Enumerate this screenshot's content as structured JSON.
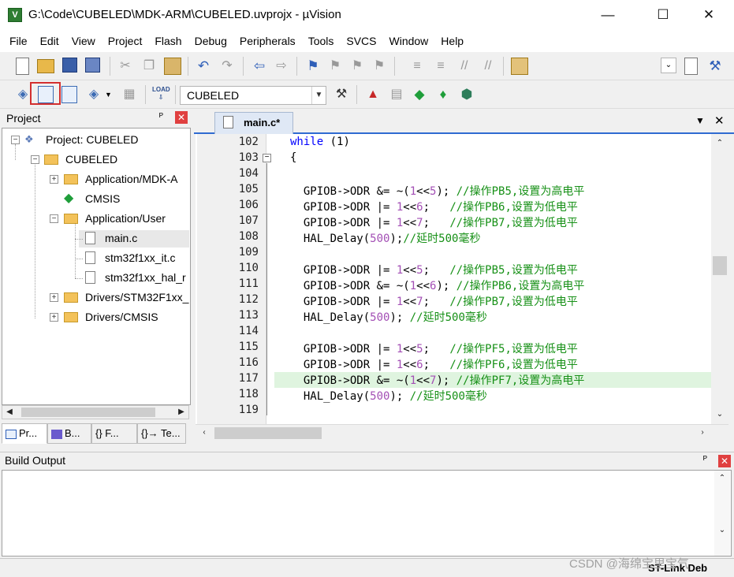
{
  "window": {
    "title": "G:\\Code\\CUBELED\\MDK-ARM\\CUBELED.uvprojx - µVision",
    "controls": {
      "minimize": "—",
      "maximize": "☐",
      "close": "✕"
    }
  },
  "menu": [
    "File",
    "Edit",
    "View",
    "Project",
    "Flash",
    "Debug",
    "Peripherals",
    "Tools",
    "SVCS",
    "Window",
    "Help"
  ],
  "toolbar2": {
    "target_value": "CUBELED",
    "highlight_color": "#d32f2f"
  },
  "project_panel": {
    "title": "Project",
    "pin": "ᴾ",
    "close": "✕",
    "tree": [
      {
        "label": "Project: CUBELED",
        "icon": "project-icon"
      },
      {
        "label": "CUBELED",
        "icon": "target-icon"
      },
      {
        "label": "Application/MDK-A",
        "icon": "folder-icon"
      },
      {
        "label": "CMSIS",
        "icon": "cmsis-icon"
      },
      {
        "label": "Application/User",
        "icon": "folder-icon"
      },
      {
        "label": "main.c",
        "icon": "file-icon"
      },
      {
        "label": "stm32f1xx_it.c",
        "icon": "file-icon"
      },
      {
        "label": "stm32f1xx_hal_r",
        "icon": "file-icon"
      },
      {
        "label": "Drivers/STM32F1xx_",
        "icon": "folder-icon"
      },
      {
        "label": "Drivers/CMSIS",
        "icon": "folder-icon"
      }
    ],
    "tabs": [
      "Pr...",
      "B...",
      "{} F...",
      "{}→ Te..."
    ]
  },
  "editor": {
    "tab_label": "main.c*",
    "menu_arrow": "▼",
    "close": "✕",
    "highlight_color": "#dff4df",
    "lines": [
      {
        "n": "102",
        "code": [
          [
            "kw",
            "while"
          ],
          [
            "",
            " (1)"
          ]
        ]
      },
      {
        "n": "103",
        "code": [
          [
            "",
            "{"
          ]
        ]
      },
      {
        "n": "104",
        "code": []
      },
      {
        "n": "105",
        "code": [
          [
            "",
            "  GPIOB->ODR &= ~("
          ],
          [
            "num",
            "1"
          ],
          [
            "",
            "<<"
          ],
          [
            "num",
            "5"
          ],
          [
            "",
            "); "
          ],
          [
            "cm",
            "//操作PB5,设置为高电平"
          ]
        ]
      },
      {
        "n": "106",
        "code": [
          [
            "",
            "  GPIOB->ODR |= "
          ],
          [
            "num",
            "1"
          ],
          [
            "",
            "<<"
          ],
          [
            "num",
            "6"
          ],
          [
            "",
            ";   "
          ],
          [
            "cm",
            "//操作PB6,设置为低电平"
          ]
        ]
      },
      {
        "n": "107",
        "code": [
          [
            "",
            "  GPIOB->ODR |= "
          ],
          [
            "num",
            "1"
          ],
          [
            "",
            "<<"
          ],
          [
            "num",
            "7"
          ],
          [
            "",
            ";   "
          ],
          [
            "cm",
            "//操作PB7,设置为低电平"
          ]
        ]
      },
      {
        "n": "108",
        "code": [
          [
            "",
            "  HAL_Delay("
          ],
          [
            "num",
            "500"
          ],
          [
            "",
            ");"
          ],
          [
            "cm",
            "//延时500毫秒"
          ]
        ]
      },
      {
        "n": "109",
        "code": []
      },
      {
        "n": "110",
        "code": [
          [
            "",
            "  GPIOB->ODR |= "
          ],
          [
            "num",
            "1"
          ],
          [
            "",
            "<<"
          ],
          [
            "num",
            "5"
          ],
          [
            "",
            ";   "
          ],
          [
            "cm",
            "//操作PB5,设置为低电平"
          ]
        ]
      },
      {
        "n": "111",
        "code": [
          [
            "",
            "  GPIOB->ODR &= ~("
          ],
          [
            "num",
            "1"
          ],
          [
            "",
            "<<"
          ],
          [
            "num",
            "6"
          ],
          [
            "",
            "); "
          ],
          [
            "cm",
            "//操作PB6,设置为高电平"
          ]
        ]
      },
      {
        "n": "112",
        "code": [
          [
            "",
            "  GPIOB->ODR |= "
          ],
          [
            "num",
            "1"
          ],
          [
            "",
            "<<"
          ],
          [
            "num",
            "7"
          ],
          [
            "",
            ";   "
          ],
          [
            "cm",
            "//操作PB7,设置为低电平"
          ]
        ]
      },
      {
        "n": "113",
        "code": [
          [
            "",
            "  HAL_Delay("
          ],
          [
            "num",
            "500"
          ],
          [
            "",
            "); "
          ],
          [
            "cm",
            "//延时500毫秒"
          ]
        ]
      },
      {
        "n": "114",
        "code": []
      },
      {
        "n": "115",
        "code": [
          [
            "",
            "  GPIOB->ODR |= "
          ],
          [
            "num",
            "1"
          ],
          [
            "",
            "<<"
          ],
          [
            "num",
            "5"
          ],
          [
            "",
            ";   "
          ],
          [
            "cm",
            "//操作PF5,设置为低电平"
          ]
        ]
      },
      {
        "n": "116",
        "code": [
          [
            "",
            "  GPIOB->ODR |= "
          ],
          [
            "num",
            "1"
          ],
          [
            "",
            "<<"
          ],
          [
            "num",
            "6"
          ],
          [
            "",
            ";   "
          ],
          [
            "cm",
            "//操作PF6,设置为低电平"
          ]
        ]
      },
      {
        "n": "117",
        "code": [
          [
            "",
            "  GPIOB->ODR &= ~("
          ],
          [
            "num",
            "1"
          ],
          [
            "",
            "<<"
          ],
          [
            "num",
            "7"
          ],
          [
            "",
            "); "
          ],
          [
            "cm",
            "//操作PF7,设置为高电平"
          ]
        ]
      },
      {
        "n": "118",
        "code": [
          [
            "",
            "  HAL_Delay("
          ],
          [
            "num",
            "500"
          ],
          [
            "",
            "); "
          ],
          [
            "cm",
            "//延时500毫秒"
          ]
        ]
      },
      {
        "n": "119",
        "code": []
      }
    ]
  },
  "build_output": {
    "title": "Build Output",
    "pin": "ᴾ",
    "close": "✕"
  },
  "statusbar": {
    "debugger": "ST-Link Deb"
  },
  "watermark": "CSDN @海绵宝里宝气"
}
